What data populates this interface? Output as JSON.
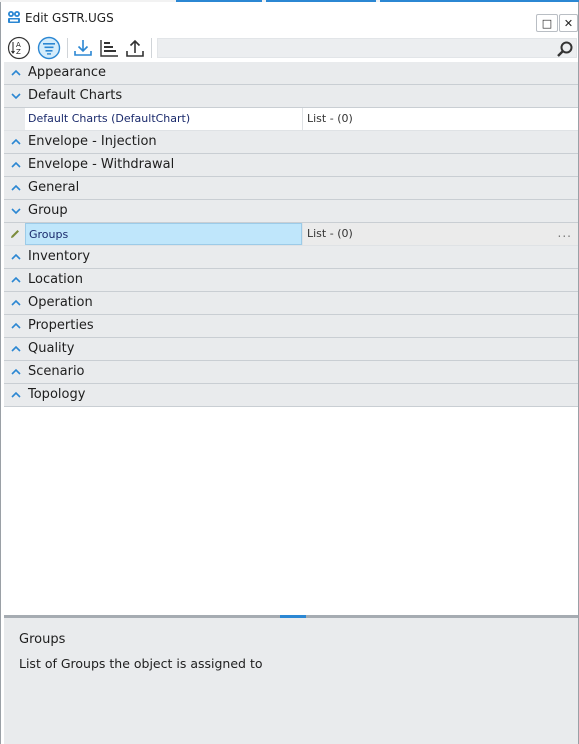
{
  "window": {
    "title": "Edit GSTR.UGS",
    "maximize_glyph": "□",
    "close_glyph": "✕"
  },
  "toolbar": {
    "buttons": [
      {
        "icon": "sort-alphabetical-icon"
      },
      {
        "icon": "categorized-view-icon",
        "active": true
      },
      {
        "icon": "import-icon"
      },
      {
        "icon": "hierarchy-icon"
      },
      {
        "icon": "export-icon"
      }
    ],
    "search": {
      "value": "",
      "placeholder": ""
    }
  },
  "grid": {
    "categories": [
      {
        "label": "Appearance",
        "expanded": false
      },
      {
        "label": "Default Charts",
        "expanded": true,
        "properties": [
          {
            "name": "Default Charts (DefaultChart)",
            "value": "List - (0)"
          }
        ]
      },
      {
        "label": "Envelope - Injection",
        "expanded": false
      },
      {
        "label": "Envelope - Withdrawal",
        "expanded": false
      },
      {
        "label": "General",
        "expanded": false
      },
      {
        "label": "Group",
        "expanded": true,
        "properties": [
          {
            "name": "Groups",
            "value": "List - (0)",
            "selected": true,
            "ellipsis": "..."
          }
        ]
      },
      {
        "label": "Inventory",
        "expanded": false
      },
      {
        "label": "Location",
        "expanded": false
      },
      {
        "label": "Operation",
        "expanded": false
      },
      {
        "label": "Properties",
        "expanded": false
      },
      {
        "label": "Quality",
        "expanded": false
      },
      {
        "label": "Scenario",
        "expanded": false
      },
      {
        "label": "Topology",
        "expanded": false
      }
    ]
  },
  "description": {
    "title": "Groups",
    "text": "List of Groups the object is assigned to"
  },
  "colors": {
    "accent": "#2b87d3",
    "selected_bg": "#bfe6fb",
    "category_bg": "#e9ebed",
    "chevron": "#2b87d3"
  }
}
